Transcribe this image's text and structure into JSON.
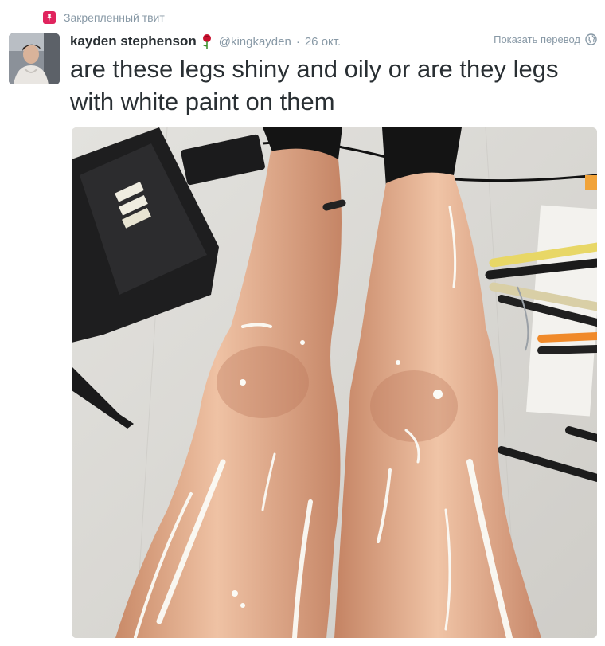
{
  "pinned_label": "Закрепленный твит",
  "author": {
    "display_name": "kayden stephenson",
    "handle": "@kingkayden",
    "date": "26 окт."
  },
  "translate_label": "Показать перевод",
  "tweet_text": "are these legs shiny and oily or are they legs with white paint on them",
  "icons": {
    "pin": "pin-icon",
    "rose": "rose-emoji-icon",
    "globe": "globe-icon"
  },
  "colors": {
    "pin_accent": "#e0245e",
    "text_primary": "#292f33",
    "text_secondary": "#8899a6"
  }
}
